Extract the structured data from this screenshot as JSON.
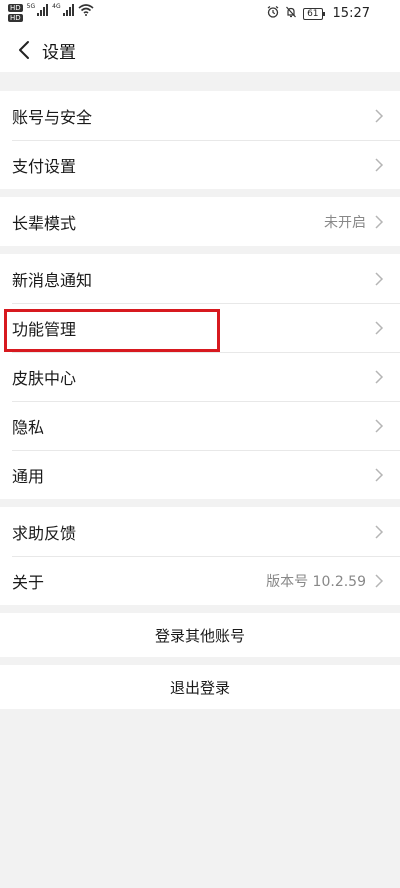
{
  "status_bar": {
    "signal1_tag": "5G",
    "signal2_tag": "4G",
    "battery": "61",
    "time": "15:27"
  },
  "nav": {
    "title": "设置"
  },
  "groups": [
    {
      "items": [
        {
          "label": "账号与安全"
        },
        {
          "label": "支付设置"
        }
      ]
    },
    {
      "items": [
        {
          "label": "长辈模式",
          "value": "未开启"
        }
      ]
    },
    {
      "items": [
        {
          "label": "新消息通知"
        },
        {
          "label": "功能管理"
        },
        {
          "label": "皮肤中心"
        },
        {
          "label": "隐私"
        },
        {
          "label": "通用"
        }
      ]
    },
    {
      "items": [
        {
          "label": "求助反馈"
        },
        {
          "label": "关于",
          "value": "版本号 10.2.59"
        }
      ]
    }
  ],
  "actions": {
    "login_other": "登录其他账号",
    "logout": "退出登录"
  },
  "colors": {
    "highlight": "#d7191f",
    "background": "#f2f2f2"
  }
}
